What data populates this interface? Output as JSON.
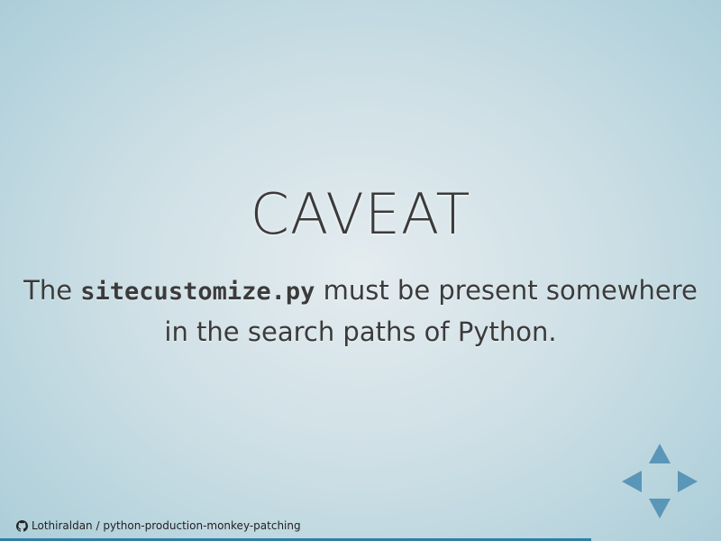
{
  "slide": {
    "title": "CAVEAT",
    "body_before": "The ",
    "body_code": "sitecustomize.py",
    "body_after": " must be present somewhere in the search paths of Python."
  },
  "footer": {
    "icon": "github-icon",
    "repo_label": "Lothiraldan / python-production-monkey-patching"
  },
  "controls": {
    "up": "up-arrow",
    "down": "down-arrow",
    "left": "left-arrow",
    "right": "right-arrow",
    "color": "#5a96b8"
  },
  "progress": {
    "fraction": 0.82,
    "color": "#2f7fa8"
  }
}
